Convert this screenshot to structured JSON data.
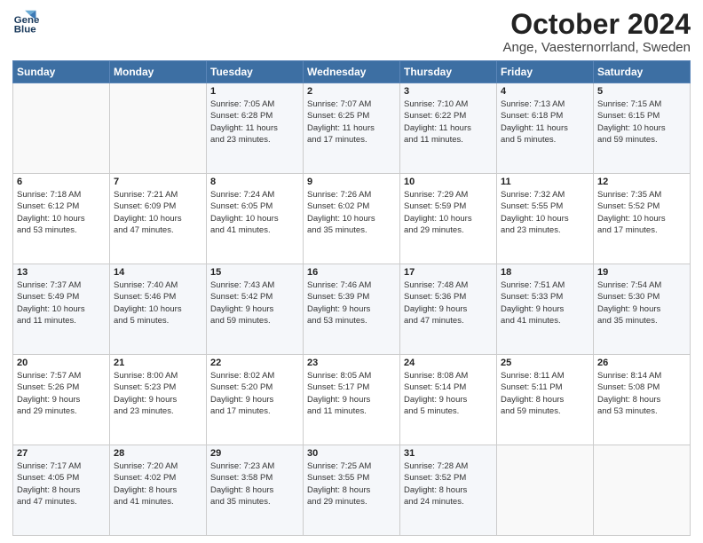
{
  "logo": {
    "line1": "General",
    "line2": "Blue"
  },
  "title": "October 2024",
  "location": "Ange, Vaesternorrland, Sweden",
  "weekdays": [
    "Sunday",
    "Monday",
    "Tuesday",
    "Wednesday",
    "Thursday",
    "Friday",
    "Saturday"
  ],
  "weeks": [
    [
      {
        "day": "",
        "info": ""
      },
      {
        "day": "",
        "info": ""
      },
      {
        "day": "1",
        "info": "Sunrise: 7:05 AM\nSunset: 6:28 PM\nDaylight: 11 hours\nand 23 minutes."
      },
      {
        "day": "2",
        "info": "Sunrise: 7:07 AM\nSunset: 6:25 PM\nDaylight: 11 hours\nand 17 minutes."
      },
      {
        "day": "3",
        "info": "Sunrise: 7:10 AM\nSunset: 6:22 PM\nDaylight: 11 hours\nand 11 minutes."
      },
      {
        "day": "4",
        "info": "Sunrise: 7:13 AM\nSunset: 6:18 PM\nDaylight: 11 hours\nand 5 minutes."
      },
      {
        "day": "5",
        "info": "Sunrise: 7:15 AM\nSunset: 6:15 PM\nDaylight: 10 hours\nand 59 minutes."
      }
    ],
    [
      {
        "day": "6",
        "info": "Sunrise: 7:18 AM\nSunset: 6:12 PM\nDaylight: 10 hours\nand 53 minutes."
      },
      {
        "day": "7",
        "info": "Sunrise: 7:21 AM\nSunset: 6:09 PM\nDaylight: 10 hours\nand 47 minutes."
      },
      {
        "day": "8",
        "info": "Sunrise: 7:24 AM\nSunset: 6:05 PM\nDaylight: 10 hours\nand 41 minutes."
      },
      {
        "day": "9",
        "info": "Sunrise: 7:26 AM\nSunset: 6:02 PM\nDaylight: 10 hours\nand 35 minutes."
      },
      {
        "day": "10",
        "info": "Sunrise: 7:29 AM\nSunset: 5:59 PM\nDaylight: 10 hours\nand 29 minutes."
      },
      {
        "day": "11",
        "info": "Sunrise: 7:32 AM\nSunset: 5:55 PM\nDaylight: 10 hours\nand 23 minutes."
      },
      {
        "day": "12",
        "info": "Sunrise: 7:35 AM\nSunset: 5:52 PM\nDaylight: 10 hours\nand 17 minutes."
      }
    ],
    [
      {
        "day": "13",
        "info": "Sunrise: 7:37 AM\nSunset: 5:49 PM\nDaylight: 10 hours\nand 11 minutes."
      },
      {
        "day": "14",
        "info": "Sunrise: 7:40 AM\nSunset: 5:46 PM\nDaylight: 10 hours\nand 5 minutes."
      },
      {
        "day": "15",
        "info": "Sunrise: 7:43 AM\nSunset: 5:42 PM\nDaylight: 9 hours\nand 59 minutes."
      },
      {
        "day": "16",
        "info": "Sunrise: 7:46 AM\nSunset: 5:39 PM\nDaylight: 9 hours\nand 53 minutes."
      },
      {
        "day": "17",
        "info": "Sunrise: 7:48 AM\nSunset: 5:36 PM\nDaylight: 9 hours\nand 47 minutes."
      },
      {
        "day": "18",
        "info": "Sunrise: 7:51 AM\nSunset: 5:33 PM\nDaylight: 9 hours\nand 41 minutes."
      },
      {
        "day": "19",
        "info": "Sunrise: 7:54 AM\nSunset: 5:30 PM\nDaylight: 9 hours\nand 35 minutes."
      }
    ],
    [
      {
        "day": "20",
        "info": "Sunrise: 7:57 AM\nSunset: 5:26 PM\nDaylight: 9 hours\nand 29 minutes."
      },
      {
        "day": "21",
        "info": "Sunrise: 8:00 AM\nSunset: 5:23 PM\nDaylight: 9 hours\nand 23 minutes."
      },
      {
        "day": "22",
        "info": "Sunrise: 8:02 AM\nSunset: 5:20 PM\nDaylight: 9 hours\nand 17 minutes."
      },
      {
        "day": "23",
        "info": "Sunrise: 8:05 AM\nSunset: 5:17 PM\nDaylight: 9 hours\nand 11 minutes."
      },
      {
        "day": "24",
        "info": "Sunrise: 8:08 AM\nSunset: 5:14 PM\nDaylight: 9 hours\nand 5 minutes."
      },
      {
        "day": "25",
        "info": "Sunrise: 8:11 AM\nSunset: 5:11 PM\nDaylight: 8 hours\nand 59 minutes."
      },
      {
        "day": "26",
        "info": "Sunrise: 8:14 AM\nSunset: 5:08 PM\nDaylight: 8 hours\nand 53 minutes."
      }
    ],
    [
      {
        "day": "27",
        "info": "Sunrise: 7:17 AM\nSunset: 4:05 PM\nDaylight: 8 hours\nand 47 minutes."
      },
      {
        "day": "28",
        "info": "Sunrise: 7:20 AM\nSunset: 4:02 PM\nDaylight: 8 hours\nand 41 minutes."
      },
      {
        "day": "29",
        "info": "Sunrise: 7:23 AM\nSunset: 3:58 PM\nDaylight: 8 hours\nand 35 minutes."
      },
      {
        "day": "30",
        "info": "Sunrise: 7:25 AM\nSunset: 3:55 PM\nDaylight: 8 hours\nand 29 minutes."
      },
      {
        "day": "31",
        "info": "Sunrise: 7:28 AM\nSunset: 3:52 PM\nDaylight: 8 hours\nand 24 minutes."
      },
      {
        "day": "",
        "info": ""
      },
      {
        "day": "",
        "info": ""
      }
    ]
  ]
}
